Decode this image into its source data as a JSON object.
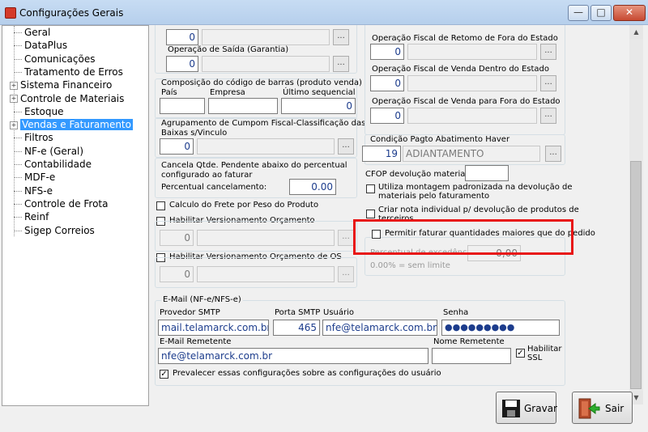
{
  "window": {
    "title": "Configurações Gerais",
    "min_label": "—",
    "max_label": "□",
    "close_label": "✕",
    "icon": "app-icon"
  },
  "tree": {
    "items": [
      {
        "label": "Geral",
        "expandable": false
      },
      {
        "label": "DataPlus",
        "expandable": false
      },
      {
        "label": "Comunicações",
        "expandable": false
      },
      {
        "label": "Tratamento de Erros",
        "expandable": false
      },
      {
        "label": "Sistema Financeiro",
        "expandable": true
      },
      {
        "label": "Controle de Materiais",
        "expandable": true
      },
      {
        "label": "Estoque",
        "expandable": false
      },
      {
        "label": "Vendas e Faturamento",
        "expandable": true,
        "selected": true
      },
      {
        "label": "Filtros",
        "expandable": false
      },
      {
        "label": "NF-e (Geral)",
        "expandable": false
      },
      {
        "label": "Contabilidade",
        "expandable": false
      },
      {
        "label": "MDF-e",
        "expandable": false
      },
      {
        "label": "NFS-e",
        "expandable": false
      },
      {
        "label": "Controle de Frota",
        "expandable": false
      },
      {
        "label": "Reinf",
        "expandable": false
      },
      {
        "label": "Sigep Correios",
        "expandable": false
      }
    ]
  },
  "left": {
    "op_top_value": "0",
    "op_saida_garantia_label": "Operação de Saída (Garantia)",
    "op_saida_garantia_value": "0",
    "barcode_group_label": "Composição do código de barras (produto venda)",
    "pais_label": "País",
    "empresa_label": "Empresa",
    "ultimo_seq_label": "Último sequencial",
    "pais_value": "",
    "empresa_value": "",
    "ultimo_seq_value": "0",
    "cupom_label_1": "Agrupamento de Cumpom Fiscal-Classificação das",
    "cupom_label_2": "Baixas s/Vinculo",
    "cupom_value": "0",
    "cancela_label_1": "Cancela Qtde. Pendente abaixo do percentual",
    "cancela_label_2": "configurado ao faturar",
    "perc_cancel_label": "Percentual cancelamento:",
    "perc_cancel_value": "0.00",
    "frete_label": "Calculo do Frete por Peso do Produto",
    "vers_orc_label": "Habilitar Versionamento Orçamento",
    "vers_orc_value": "0",
    "vers_os_label": "Habilitar Versionamento Orçamento de OS",
    "vers_os_value": "0"
  },
  "right": {
    "retorno_label": "Operação Fiscal de Retomo de Fora do Estado",
    "retorno_value": "0",
    "venda_dentro_label": "Operação Fiscal de Venda Dentro do Estado",
    "venda_dentro_value": "0",
    "venda_fora_label": "Operação Fiscal de Venda para Fora do Estado",
    "venda_fora_value": "0",
    "cond_pagto_label": "Condição Pagto Abatimento Haver",
    "cond_pagto_code": "19",
    "cond_pagto_desc": "ADIANTAMENTO",
    "cfop_label": "CFOP devolução materiais:",
    "cfop_value": "",
    "montagem_label_1": "Utiliza montagem padronizada na devolução de",
    "montagem_label_2": "materiais pelo faturamento",
    "nota_individual_label_1": "Criar nota individual p/ devolução de produtos de",
    "nota_individual_label_2": "terceiros",
    "permitir_label": "Permitir faturar quantidades maiores que do pedido",
    "perc_excedencia_label": "Percentual de excedência:",
    "perc_excedencia_value": "0,00",
    "sem_limite_label": "0.00% = sem limite"
  },
  "email": {
    "group_label": "E-Mail (NF-e/NFS-e)",
    "provedor_label": "Provedor SMTP",
    "provedor_value": "mail.telamarck.com.br",
    "porta_label": "Porta SMTP",
    "porta_value": "465",
    "usuario_label": "Usuário",
    "usuario_value": "nfe@telamarck.com.br",
    "senha_label": "Senha",
    "senha_value": "●●●●●●●●●",
    "remetente_label": "E-Mail Remetente",
    "remetente_value": "nfe@telamarck.com.br",
    "nome_remetente_label": "Nome Remetente",
    "nome_remetente_value": "",
    "ssl_label_1": "Habilitar",
    "ssl_label_2": "SSL",
    "prevalecer_label": "Prevalecer essas configurações sobre as configurações do usuário"
  },
  "buttons": {
    "gravar_label": "Gravar",
    "sair_label": "Sair"
  },
  "dots_label": "...",
  "check_mark": "✓",
  "colors": {
    "selection": "#3399ff",
    "highlight_box": "#e81515",
    "value_text": "#1c3c8c"
  }
}
